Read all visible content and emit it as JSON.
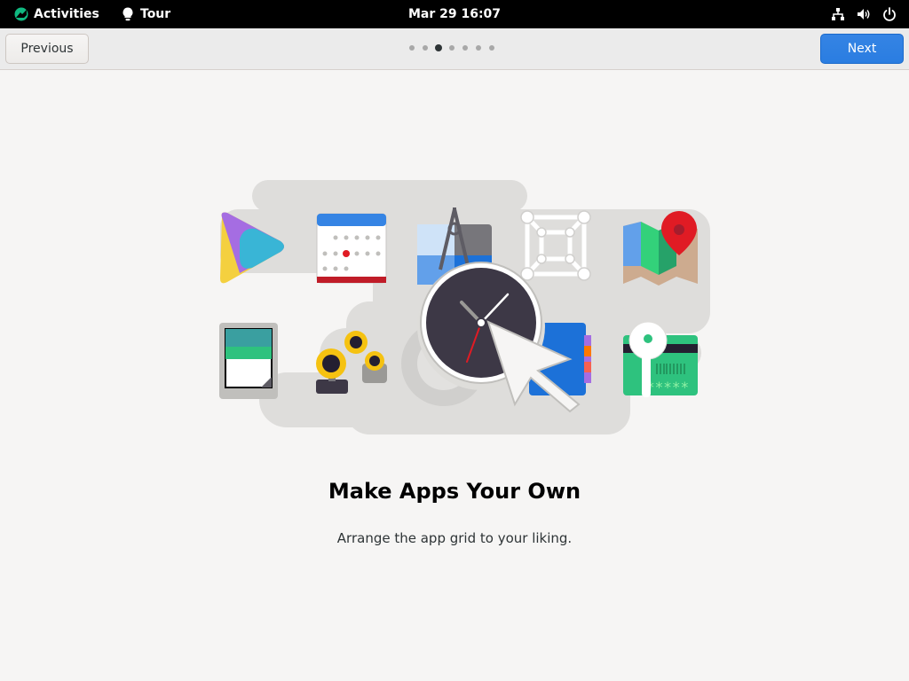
{
  "topbar": {
    "activities_label": "Activities",
    "app_name": "Tour",
    "clock": "Mar 29  16:07",
    "icons": [
      "network-wired-icon",
      "volume-icon",
      "power-icon"
    ]
  },
  "header": {
    "previous_label": "Previous",
    "next_label": "Next",
    "page_count": 7,
    "current_page": 3
  },
  "content": {
    "title": "Make Apps Your Own",
    "subtitle": "Arrange the app grid to your liking.",
    "password_text": "*****"
  },
  "colors": {
    "accent": "#3584e4",
    "background": "#f6f5f4",
    "topbar": "#000000"
  }
}
